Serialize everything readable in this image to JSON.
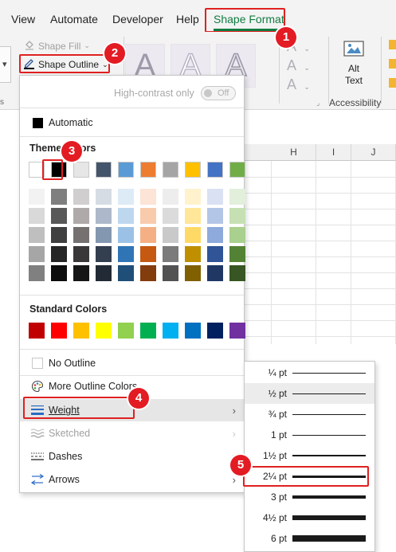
{
  "tabs": [
    {
      "label": "View"
    },
    {
      "label": "Automate"
    },
    {
      "label": "Developer"
    },
    {
      "label": "Help"
    },
    {
      "label": "Shape Format",
      "active": true
    }
  ],
  "ribbon": {
    "shape_fill": "Shape Fill",
    "shape_outline": "Shape Outline",
    "alt_text": "Alt\nText",
    "alt_text_line1": "Alt",
    "alt_text_line2": "Text",
    "accessibility_group": "Accessibility",
    "wordart_letter": "A"
  },
  "columns": [
    "H",
    "I",
    "J"
  ],
  "menu": {
    "high_contrast_label": "High-contrast only",
    "toggle_state": "Off",
    "automatic": "Automatic",
    "theme_colors_title": "Theme Colors",
    "standard_colors_title": "Standard Colors",
    "no_outline": "No Outline",
    "more_colors": "More Outline Colors...",
    "weight": "Weight",
    "sketched": "Sketched",
    "dashes": "Dashes",
    "arrows": "Arrows"
  },
  "theme_colors": [
    "#ffffff",
    "#000000",
    "#e7e6e6",
    "#44546a",
    "#5b9bd5",
    "#ed7d31",
    "#a5a5a5",
    "#ffc000",
    "#4472c4",
    "#70ad47"
  ],
  "theme_shades": [
    [
      "#f2f2f2",
      "#d9d9d9",
      "#bfbfbf",
      "#a6a6a6",
      "#808080"
    ],
    [
      "#7f7f7f",
      "#595959",
      "#404040",
      "#262626",
      "#0d0d0d"
    ],
    [
      "#d0cece",
      "#aeaaaa",
      "#757171",
      "#3a3838",
      "#171616"
    ],
    [
      "#d6dce4",
      "#adb9ca",
      "#8497b0",
      "#333f4f",
      "#222a35"
    ],
    [
      "#ddebf7",
      "#bdd7ee",
      "#9bc2e6",
      "#2f75b5",
      "#1f4e78"
    ],
    [
      "#fce4d6",
      "#f8cbad",
      "#f4b084",
      "#c65911",
      "#833c0c"
    ],
    [
      "#ededed",
      "#dbdbdb",
      "#c9c9c9",
      "#7b7b7b",
      "#525252"
    ],
    [
      "#fff2cc",
      "#ffe699",
      "#ffd966",
      "#bf8f00",
      "#806000"
    ],
    [
      "#d9e1f2",
      "#b4c6e7",
      "#8ea9db",
      "#305496",
      "#203764"
    ],
    [
      "#e2efda",
      "#c6e0b4",
      "#a9d08e",
      "#548235",
      "#375623"
    ]
  ],
  "standard_colors": [
    "#c00000",
    "#ff0000",
    "#ffc000",
    "#ffff00",
    "#92d050",
    "#00b050",
    "#00b0f0",
    "#0070c0",
    "#002060",
    "#7030a0"
  ],
  "weights": [
    {
      "label": "¼ pt",
      "thickness": 0.25
    },
    {
      "label": "½ pt",
      "thickness": 0.5,
      "hovered": true
    },
    {
      "label": "¾ pt",
      "thickness": 0.75
    },
    {
      "label": "1 pt",
      "thickness": 1
    },
    {
      "label": "1½ pt",
      "thickness": 1.5
    },
    {
      "label": "2¼ pt",
      "thickness": 2.25,
      "selected": true
    },
    {
      "label": "3 pt",
      "thickness": 3
    },
    {
      "label": "4½ pt",
      "thickness": 4.5
    },
    {
      "label": "6 pt",
      "thickness": 6
    }
  ],
  "badges": [
    "1",
    "2",
    "3",
    "4",
    "5"
  ]
}
